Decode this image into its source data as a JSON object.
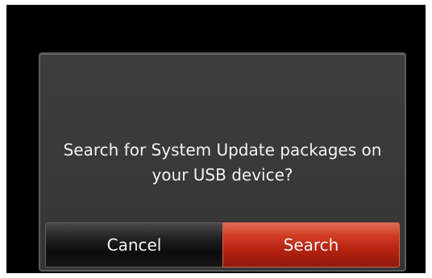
{
  "dialog": {
    "message_line1": "Search for System Update packages on",
    "message_line2": "your USB device?"
  },
  "buttons": {
    "cancel_label": "Cancel",
    "search_label": "Search"
  },
  "colors": {
    "background": "#000000",
    "dialog": "#3a3a3a",
    "search_button": "#c42d18",
    "cancel_button": "#111111"
  }
}
